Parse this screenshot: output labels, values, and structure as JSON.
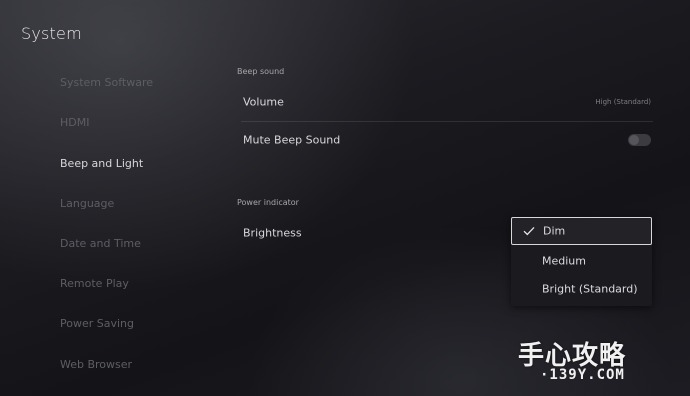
{
  "header": {
    "title": "System"
  },
  "sidebar": {
    "items": [
      {
        "label": "System Software",
        "active": false
      },
      {
        "label": "HDMI",
        "active": false
      },
      {
        "label": "Beep and Light",
        "active": true
      },
      {
        "label": "Language",
        "active": false
      },
      {
        "label": "Date and Time",
        "active": false
      },
      {
        "label": "Remote Play",
        "active": false
      },
      {
        "label": "Power Saving",
        "active": false
      },
      {
        "label": "Web Browser",
        "active": false
      }
    ]
  },
  "beep_sound": {
    "section_label": "Beep sound",
    "volume": {
      "label": "Volume",
      "value": "High (Standard)"
    },
    "mute": {
      "label": "Mute Beep Sound",
      "enabled": false
    }
  },
  "power_indicator": {
    "section_label": "Power indicator",
    "brightness": {
      "label": "Brightness"
    },
    "options": [
      {
        "label": "Dim",
        "selected": true
      },
      {
        "label": "Medium",
        "selected": false
      },
      {
        "label": "Bright (Standard)",
        "selected": false
      }
    ]
  },
  "watermark": {
    "logo_text": "手心攻略",
    "url_text": "·139Y.COM"
  }
}
